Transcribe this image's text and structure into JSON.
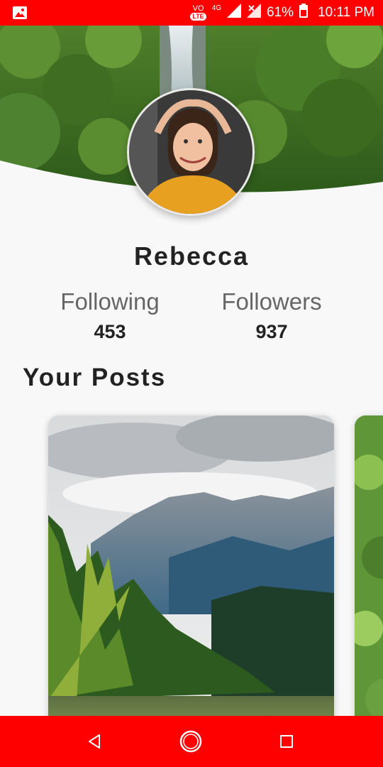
{
  "status_bar": {
    "volte_top": "VO",
    "volte_bottom": "LTE",
    "network": "4G",
    "battery": "61%",
    "time": "10:11 PM",
    "background_color": "#ff0000"
  },
  "profile": {
    "name": "Rebecca",
    "following_label": "Following",
    "following_count": "453",
    "followers_label": "Followers",
    "followers_count": "937"
  },
  "posts": {
    "title": "Your Posts"
  },
  "nav_bar": {
    "background_color": "#ff0000",
    "icons": [
      "back-icon",
      "home-icon",
      "recent-apps-icon"
    ]
  }
}
